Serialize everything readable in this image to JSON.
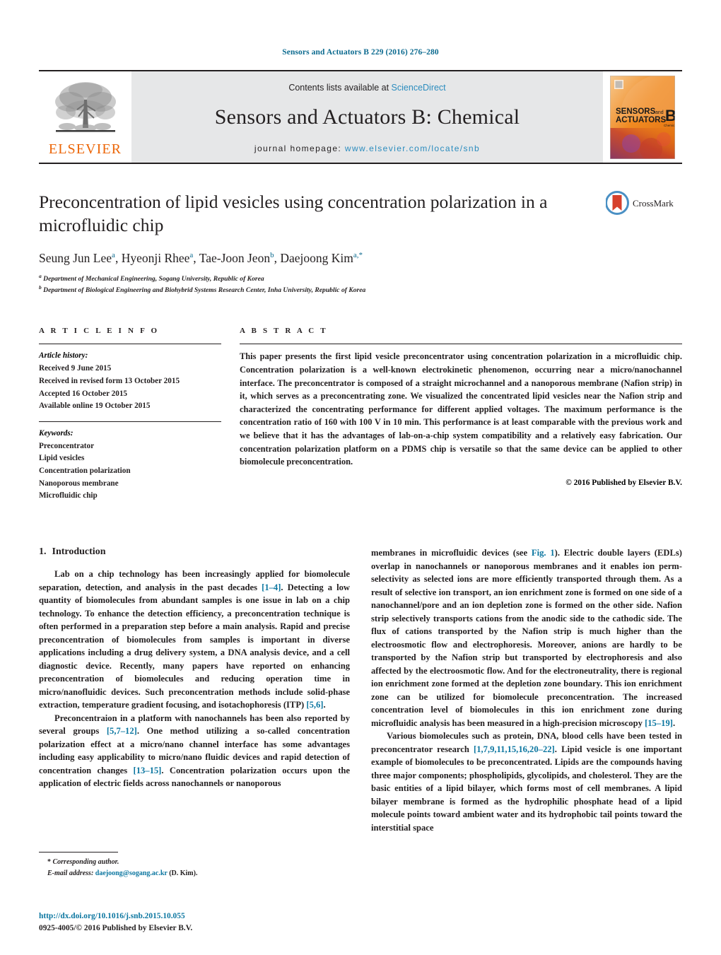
{
  "running_head": "Sensors and Actuators B 229 (2016) 276–280",
  "masthead": {
    "contents_prefix": "Contents lists available at ",
    "sciencedirect": "ScienceDirect",
    "journal_title": "Sensors and Actuators B: Chemical",
    "homepage_label": "journal homepage:",
    "homepage_url": "www.elsevier.com/locate/snb",
    "publisher_logo_text": "ELSEVIER",
    "publisher_logo_icon": "elsevier-tree-icon",
    "cover_line1": "SENSORS",
    "cover_and": "and",
    "cover_line2": "ACTUATORS",
    "cover_letter": "B",
    "cover_sub": "Chemical",
    "accent_orange": "#ec6608",
    "accent_blue": "#2b8cbe",
    "band_gray": "#e6e7e8"
  },
  "title_block": {
    "title": "Preconcentration of lipid vesicles using concentration polarization in a microfluidic chip",
    "authors": [
      {
        "name": "Seung Jun Lee",
        "sup": "a"
      },
      {
        "name": "Hyeonji Rhee",
        "sup": "a"
      },
      {
        "name": "Tae-Joon Jeon",
        "sup": "b"
      },
      {
        "name": "Daejoong Kim",
        "sup": "a,*"
      }
    ],
    "affiliations": [
      {
        "marker": "a",
        "text": "Department of Mechanical Engineering, Sogang University, Republic of Korea"
      },
      {
        "marker": "b",
        "text": "Department of Biological Engineering and Biohybrid Systems Research Center, Inha University, Republic of Korea"
      }
    ],
    "crossmark_label": "CrossMark",
    "crossmark_icon": "crossmark-icon"
  },
  "article_info": {
    "heading": "A R T I C L E   I N F O",
    "history_label": "Article history:",
    "history": [
      "Received 9 June 2015",
      "Received in revised form 13 October 2015",
      "Accepted 16 October 2015",
      "Available online 19 October 2015"
    ],
    "keywords_label": "Keywords:",
    "keywords": [
      "Preconcentrator",
      "Lipid vesicles",
      "Concentration polarization",
      "Nanoporous membrane",
      "Microfluidic chip"
    ]
  },
  "abstract": {
    "heading": "A B S T R A C T",
    "text": "This paper presents the first lipid vesicle preconcentrator using concentration polarization in a microfluidic chip. Concentration polarization is a well-known electrokinetic phenomenon, occurring near a micro/nanochannel interface. The preconcentrator is composed of a straight microchannel and a nanoporous membrane (Nafion strip) in it, which serves as a preconcentrating zone. We visualized the concentrated lipid vesicles near the Nafion strip and characterized the concentrating performance for different applied voltages. The maximum performance is the concentration ratio of 160 with 100 V in 10 min. This performance is at least comparable with the previous work and we believe that it has the advantages of lab-on-a-chip system compatibility and a relatively easy fabrication. Our concentration polarization platform on a PDMS chip is versatile so that the same device can be applied to other biomolecule preconcentration.",
    "copyright": "© 2016 Published by Elsevier B.V."
  },
  "introduction": {
    "section_number": "1.",
    "section_title": "Introduction",
    "left_p1_a": "Lab on a chip technology has been increasingly applied for biomolecule separation, detection, and analysis in the past decades ",
    "left_p1_ref1": "[1–4]",
    "left_p1_b": ". Detecting a low quantity of biomolecules from abundant samples is one issue in lab on a chip technology. To enhance the detection efficiency, a preconcentration technique is often performed in a preparation step before a main analysis. Rapid and precise preconcentration of biomolecules from samples is important in diverse applications including a drug delivery system, a DNA analysis device, and a cell diagnostic device. Recently, many papers have reported on enhancing preconcentration of biomolecules and reducing operation time in micro/nanofluidic devices. Such preconcentration methods include solid-phase extraction, temperature gradient focusing, and isotachophoresis (ITP) ",
    "left_p1_ref2": "[5,6]",
    "left_p1_c": ".",
    "left_p2_a": "Preconcentraion in a platform with nanochannels has been also reported by several groups ",
    "left_p2_ref1": "[5,7–12]",
    "left_p2_b": ". One method utilizing a so-called concentration polarization effect at a micro/nano channel interface has some advantages including easy applicability to micro/nano fluidic devices and rapid detection of concentration changes ",
    "left_p2_ref2": "[13–15]",
    "left_p2_c": ". Concentration polarization occurs upon the application of electric fields across nanochannels or nanoporous",
    "right_p1_a": "membranes in microfluidic devices (see ",
    "right_p1_fig": "Fig. 1",
    "right_p1_b": "). Electric double layers (EDLs) overlap in nanochannels or nanoporous membranes and it enables ion perm-selectivity as selected ions are more efficiently transported through them. As a result of selective ion transport, an ion enrichment zone is formed on one side of a nanochannel/pore and an ion depletion zone is formed on the other side. Nafion strip selectively transports cations from the anodic side to the cathodic side. The flux of cations transported by the Nafion strip is much higher than the electroosmotic flow and electrophoresis. Moreover, anions are hardly to be transported by the Nafion strip but transported by electrophoresis and also affected by the electroosmotic flow. And for the electroneutrality, there is regional ion enrichment zone formed at the depletion zone boundary. This ion enrichment zone can be utilized for biomolecule preconcentration. The increased concentration level of biomolecules in this ion enrichment zone during microfluidic analysis has been measured in a high-precision microscopy ",
    "right_p1_ref": "[15–19]",
    "right_p1_c": ".",
    "right_p2_a": "Various biomolecules such as protein, DNA, blood cells have been tested in preconcentrator research ",
    "right_p2_ref": "[1,7,9,11,15,16,20–22]",
    "right_p2_b": ". Lipid vesicle is one important example of biomolecules to be preconcentrated. Lipids are the compounds having three major components; phospholipids, glycolipids, and cholesterol. They are the basic entities of a lipid bilayer, which forms most of cell membranes. A lipid bilayer membrane is formed as the hydrophilic phosphate head of a lipid molecule points toward ambient water and its hydrophobic tail points toward the interstitial space"
  },
  "footnotes": {
    "corresponding_marker": "*",
    "corresponding_text": "Corresponding author.",
    "email_label": "E-mail address:",
    "email": "daejoong@sogang.ac.kr",
    "email_owner": "(D. Kim)."
  },
  "footer": {
    "doi": "http://dx.doi.org/10.1016/j.snb.2015.10.055",
    "issn_line": "0925-4005/© 2016 Published by Elsevier B.V."
  }
}
